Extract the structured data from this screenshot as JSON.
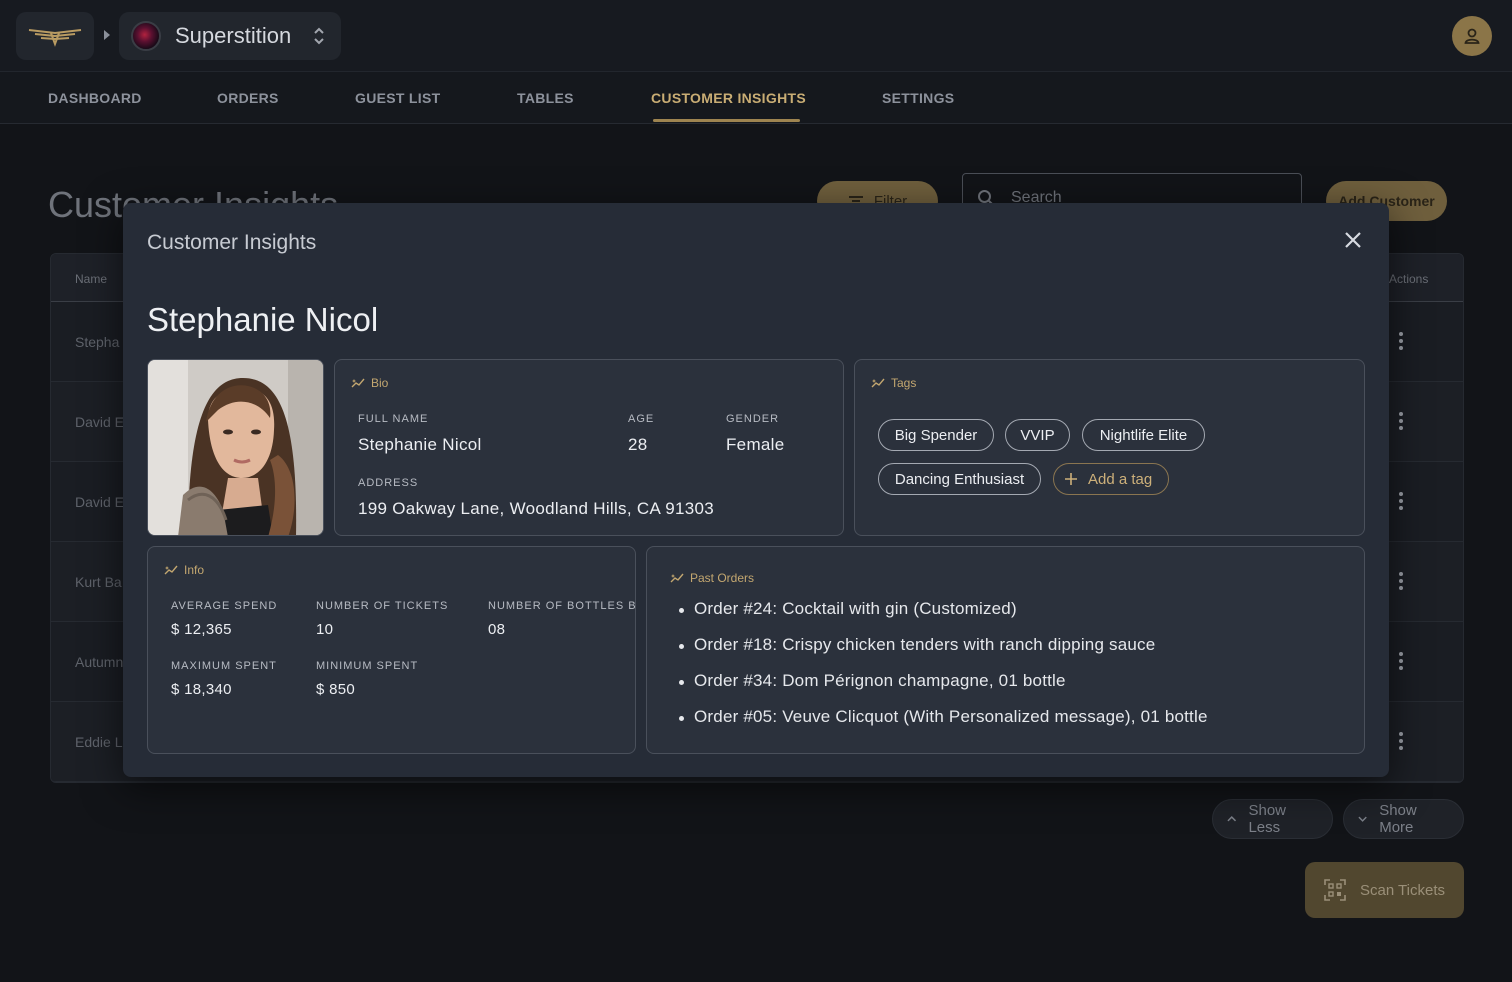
{
  "topbar": {
    "venue_name": "Superstition"
  },
  "nav": {
    "tabs": [
      {
        "label": "DASHBOARD"
      },
      {
        "label": "ORDERS"
      },
      {
        "label": "GUEST LIST"
      },
      {
        "label": "TABLES"
      },
      {
        "label": "CUSTOMER INSIGHTS"
      },
      {
        "label": "SETTINGS"
      }
    ],
    "active_tab": "CUSTOMER INSIGHTS"
  },
  "page": {
    "title": "Customer Insights",
    "filter_label": "Filter",
    "search_placeholder": "Search",
    "add_customer_label": "Add Customer",
    "table": {
      "headers": {
        "name": "Name",
        "actions": "Actions"
      },
      "rows": [
        {
          "name": "Stepha"
        },
        {
          "name": "David E"
        },
        {
          "name": "David E"
        },
        {
          "name": "Kurt Ba"
        },
        {
          "name": "Autumn"
        },
        {
          "name": "Eddie L"
        }
      ]
    },
    "show_less_label": "Show Less",
    "show_more_label": "Show More",
    "scan_tickets_label": "Scan Tickets"
  },
  "modal": {
    "title": "Customer Insights",
    "customer_name": "Stephanie Nicol",
    "bio": {
      "label": "Bio",
      "full_name_label": "FULL NAME",
      "full_name": "Stephanie Nicol",
      "age_label": "AGE",
      "age": "28",
      "gender_label": "GENDER",
      "gender": "Female",
      "address_label": "ADDRESS",
      "address": "199 Oakway Lane, Woodland Hills, CA 91303"
    },
    "tags": {
      "label": "Tags",
      "items": [
        "Big Spender",
        "VVIP",
        "Nightlife Elite",
        "Dancing Enthusiast"
      ],
      "add_label": "Add a tag"
    },
    "info": {
      "label": "Info",
      "average_spend_label": "AVERAGE SPEND",
      "average_spend": "$ 12,365",
      "tickets_label": "NUMBER OF TICKETS",
      "tickets": "10",
      "bottles_label": "NUMBER OF BOTTLES BO",
      "bottles": "08",
      "max_spent_label": "MAXIMUM SPENT",
      "max_spent": "$ 18,340",
      "min_spent_label": "MINIMUM SPENT",
      "min_spent": "$ 850"
    },
    "past_orders": {
      "label": "Past Orders",
      "items": [
        "Order #24: Cocktail with gin (Customized)",
        "Order #18: Crispy chicken tenders with ranch dipping sauce",
        "Order #34: Dom Pérignon champagne, 01 bottle",
        "Order #05: Veuve Clicquot (With Personalized message), 01 bottle"
      ]
    }
  },
  "colors": {
    "accent": "#c9ad74",
    "modal_bg": "#262c37",
    "page_bg": "#121418"
  }
}
